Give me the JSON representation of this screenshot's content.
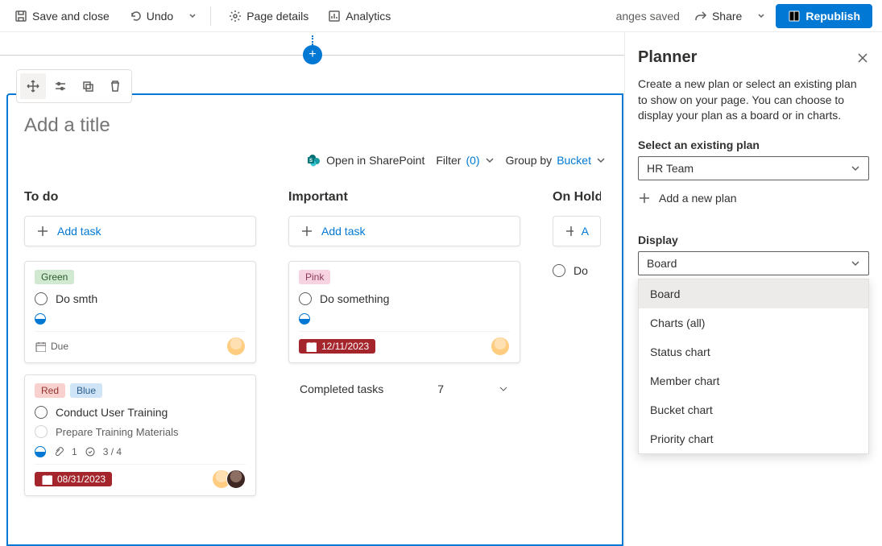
{
  "toolbar": {
    "save": "Save and close",
    "undo": "Undo",
    "pageDetails": "Page details",
    "analytics": "Analytics",
    "status": "anges saved",
    "share": "Share",
    "republish": "Republish"
  },
  "webpart": {
    "titlePlaceholder": "Add a title",
    "openIn": "Open in SharePoint",
    "filterLabel": "Filter",
    "filterCount": "(0)",
    "groupByLabel": "Group by",
    "groupByValue": "Bucket"
  },
  "buckets": [
    {
      "name": "To do",
      "addTask": "Add task",
      "cards": [
        {
          "tags": [
            {
              "text": "Green",
              "cls": "green"
            }
          ],
          "tasks": [
            {
              "text": "Do smth",
              "done": false
            }
          ],
          "progress": true,
          "due": {
            "text": "Due",
            "overdue": false
          },
          "avatars": [
            "a1"
          ]
        },
        {
          "tags": [
            {
              "text": "Red",
              "cls": "red"
            },
            {
              "text": "Blue",
              "cls": "blue"
            }
          ],
          "tasks": [
            {
              "text": "Conduct User Training",
              "done": false
            },
            {
              "text": "Prepare Training Materials",
              "done": false,
              "faded": true
            }
          ],
          "progress": true,
          "attach": "1",
          "checklist": "3 / 4",
          "due": {
            "text": "08/31/2023",
            "overdue": true
          },
          "avatars": [
            "a1",
            "a2"
          ]
        }
      ]
    },
    {
      "name": "Important",
      "addTask": "Add task",
      "cards": [
        {
          "tags": [
            {
              "text": "Pink",
              "cls": "pink"
            }
          ],
          "tasks": [
            {
              "text": "Do something",
              "done": false
            }
          ],
          "progress": true,
          "due": {
            "text": "12/11/2023",
            "overdue": true
          },
          "avatars": [
            "a1"
          ]
        }
      ],
      "completed": {
        "label": "Completed tasks",
        "count": "7"
      }
    },
    {
      "name": "On Hold",
      "addTask": "A",
      "holderTask": "Do"
    }
  ],
  "pane": {
    "title": "Planner",
    "desc": "Create a new plan or select an existing plan to show on your page. You can choose to display your plan as a board or in charts.",
    "selectPlanLabel": "Select an existing plan",
    "selectedPlan": "HR Team",
    "addNewPlan": "Add a new plan",
    "displayLabel": "Display",
    "displayValue": "Board",
    "displayOptions": [
      "Board",
      "Charts (all)",
      "Status chart",
      "Member chart",
      "Bucket chart",
      "Priority chart"
    ]
  }
}
